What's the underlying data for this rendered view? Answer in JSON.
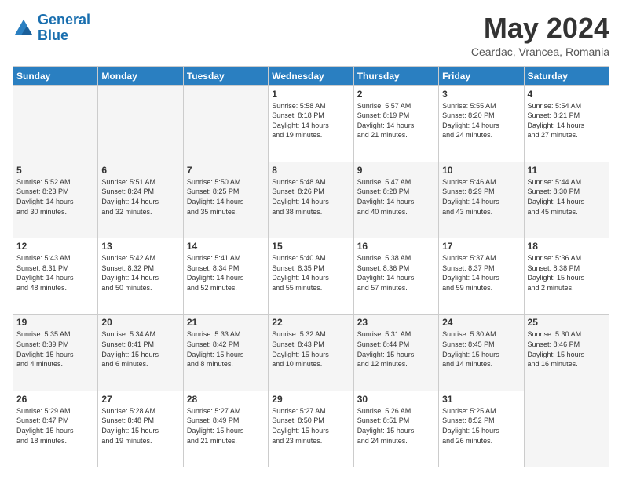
{
  "logo": {
    "line1": "General",
    "line2": "Blue"
  },
  "title": "May 2024",
  "location": "Ceardac, Vrancea, Romania",
  "days_of_week": [
    "Sunday",
    "Monday",
    "Tuesday",
    "Wednesday",
    "Thursday",
    "Friday",
    "Saturday"
  ],
  "weeks": [
    [
      {
        "num": "",
        "info": ""
      },
      {
        "num": "",
        "info": ""
      },
      {
        "num": "",
        "info": ""
      },
      {
        "num": "1",
        "info": "Sunrise: 5:58 AM\nSunset: 8:18 PM\nDaylight: 14 hours\nand 19 minutes."
      },
      {
        "num": "2",
        "info": "Sunrise: 5:57 AM\nSunset: 8:19 PM\nDaylight: 14 hours\nand 21 minutes."
      },
      {
        "num": "3",
        "info": "Sunrise: 5:55 AM\nSunset: 8:20 PM\nDaylight: 14 hours\nand 24 minutes."
      },
      {
        "num": "4",
        "info": "Sunrise: 5:54 AM\nSunset: 8:21 PM\nDaylight: 14 hours\nand 27 minutes."
      }
    ],
    [
      {
        "num": "5",
        "info": "Sunrise: 5:52 AM\nSunset: 8:23 PM\nDaylight: 14 hours\nand 30 minutes."
      },
      {
        "num": "6",
        "info": "Sunrise: 5:51 AM\nSunset: 8:24 PM\nDaylight: 14 hours\nand 32 minutes."
      },
      {
        "num": "7",
        "info": "Sunrise: 5:50 AM\nSunset: 8:25 PM\nDaylight: 14 hours\nand 35 minutes."
      },
      {
        "num": "8",
        "info": "Sunrise: 5:48 AM\nSunset: 8:26 PM\nDaylight: 14 hours\nand 38 minutes."
      },
      {
        "num": "9",
        "info": "Sunrise: 5:47 AM\nSunset: 8:28 PM\nDaylight: 14 hours\nand 40 minutes."
      },
      {
        "num": "10",
        "info": "Sunrise: 5:46 AM\nSunset: 8:29 PM\nDaylight: 14 hours\nand 43 minutes."
      },
      {
        "num": "11",
        "info": "Sunrise: 5:44 AM\nSunset: 8:30 PM\nDaylight: 14 hours\nand 45 minutes."
      }
    ],
    [
      {
        "num": "12",
        "info": "Sunrise: 5:43 AM\nSunset: 8:31 PM\nDaylight: 14 hours\nand 48 minutes."
      },
      {
        "num": "13",
        "info": "Sunrise: 5:42 AM\nSunset: 8:32 PM\nDaylight: 14 hours\nand 50 minutes."
      },
      {
        "num": "14",
        "info": "Sunrise: 5:41 AM\nSunset: 8:34 PM\nDaylight: 14 hours\nand 52 minutes."
      },
      {
        "num": "15",
        "info": "Sunrise: 5:40 AM\nSunset: 8:35 PM\nDaylight: 14 hours\nand 55 minutes."
      },
      {
        "num": "16",
        "info": "Sunrise: 5:38 AM\nSunset: 8:36 PM\nDaylight: 14 hours\nand 57 minutes."
      },
      {
        "num": "17",
        "info": "Sunrise: 5:37 AM\nSunset: 8:37 PM\nDaylight: 14 hours\nand 59 minutes."
      },
      {
        "num": "18",
        "info": "Sunrise: 5:36 AM\nSunset: 8:38 PM\nDaylight: 15 hours\nand 2 minutes."
      }
    ],
    [
      {
        "num": "19",
        "info": "Sunrise: 5:35 AM\nSunset: 8:39 PM\nDaylight: 15 hours\nand 4 minutes."
      },
      {
        "num": "20",
        "info": "Sunrise: 5:34 AM\nSunset: 8:41 PM\nDaylight: 15 hours\nand 6 minutes."
      },
      {
        "num": "21",
        "info": "Sunrise: 5:33 AM\nSunset: 8:42 PM\nDaylight: 15 hours\nand 8 minutes."
      },
      {
        "num": "22",
        "info": "Sunrise: 5:32 AM\nSunset: 8:43 PM\nDaylight: 15 hours\nand 10 minutes."
      },
      {
        "num": "23",
        "info": "Sunrise: 5:31 AM\nSunset: 8:44 PM\nDaylight: 15 hours\nand 12 minutes."
      },
      {
        "num": "24",
        "info": "Sunrise: 5:30 AM\nSunset: 8:45 PM\nDaylight: 15 hours\nand 14 minutes."
      },
      {
        "num": "25",
        "info": "Sunrise: 5:30 AM\nSunset: 8:46 PM\nDaylight: 15 hours\nand 16 minutes."
      }
    ],
    [
      {
        "num": "26",
        "info": "Sunrise: 5:29 AM\nSunset: 8:47 PM\nDaylight: 15 hours\nand 18 minutes."
      },
      {
        "num": "27",
        "info": "Sunrise: 5:28 AM\nSunset: 8:48 PM\nDaylight: 15 hours\nand 19 minutes."
      },
      {
        "num": "28",
        "info": "Sunrise: 5:27 AM\nSunset: 8:49 PM\nDaylight: 15 hours\nand 21 minutes."
      },
      {
        "num": "29",
        "info": "Sunrise: 5:27 AM\nSunset: 8:50 PM\nDaylight: 15 hours\nand 23 minutes."
      },
      {
        "num": "30",
        "info": "Sunrise: 5:26 AM\nSunset: 8:51 PM\nDaylight: 15 hours\nand 24 minutes."
      },
      {
        "num": "31",
        "info": "Sunrise: 5:25 AM\nSunset: 8:52 PM\nDaylight: 15 hours\nand 26 minutes."
      },
      {
        "num": "",
        "info": ""
      }
    ]
  ]
}
